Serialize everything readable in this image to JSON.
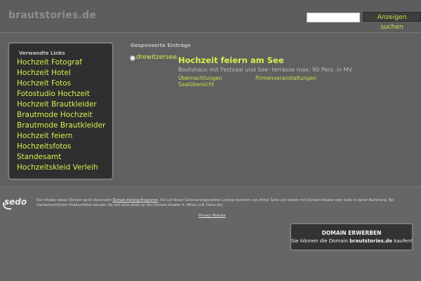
{
  "header": {
    "logo": "brautstories.de",
    "search_placeholder": "",
    "search_button": "Anzeigen suchen"
  },
  "sidebar": {
    "title": "Verwandte Links",
    "items": [
      "Hochzeit Fotograf",
      "Hochzeit Hotel",
      "Hochzeit Fotos",
      "Fotostudio Hochzeit",
      "Hochzeit Brautkleider",
      "Brautmode Hochzeit",
      "Brautmode Brautkleider",
      "Hochzeit feiern",
      "Hochzeitsfotos",
      "Standesamt",
      "Hochzeitskleid Verleih"
    ]
  },
  "sponsored": {
    "label": "Gesponserte Einträge",
    "result": {
      "url": "drewitzersee....",
      "title": "Hochzeit feiern am See",
      "description": "Bootshaus mit Festsaal und See- terrasse max. 90 Pers. in MV",
      "links": [
        "Übernachtungen",
        "Firmenveranstaltungen",
        "Saalübersicht"
      ]
    }
  },
  "footer": {
    "sedo_logo": "sedo",
    "disclaimer_pre": "Der Inhaber dieser Domain parkt diese beim ",
    "disclaimer_link": "Domain-Parking-Programm",
    "disclaimer_post": ". Die auf dieser Seite bereitgestellten Listings kommen von dritter Seite und stehen mit Domain-Inhaber oder Sedo in keiner Beziehung. Bei markenrechtlichen Problemfällen wenden Sie sich bitte direkt an den Domain-Inhaber lt. Whois (z.B. Denic.de).",
    "privacy": "Privacy Policies",
    "domain_box_title": "DOMAIN ERWERBEN",
    "domain_box_pre": "Sie können die Domain ",
    "domain_box_domain": "brautstories.de",
    "domain_box_post": " kaufen!"
  }
}
